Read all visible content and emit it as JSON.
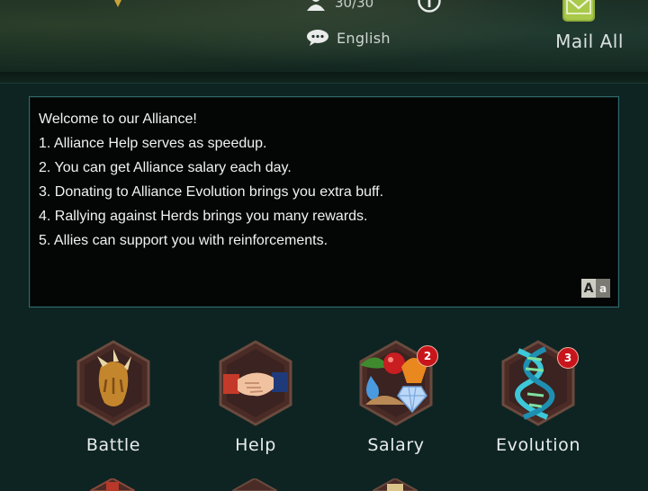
{
  "header": {
    "member_count": "30/30",
    "language": "English",
    "mail_all_label": "Mail All"
  },
  "announcement": {
    "lines": [
      "Welcome to our Alliance!",
      "1. Alliance Help serves as speedup.",
      "2. You can get Alliance salary each day.",
      "3. Donating to Alliance Evolution brings you extra buff.",
      "4. Rallying against Herds brings you many rewards.",
      "5. Allies can support you with reinforcements."
    ],
    "font_button": {
      "big": "A",
      "small": "a"
    }
  },
  "menu": [
    {
      "label": "Battle",
      "icon": "claw-icon"
    },
    {
      "label": "Help",
      "icon": "handshake-icon"
    },
    {
      "label": "Salary",
      "icon": "resources-icon",
      "badge": "2"
    },
    {
      "label": "Evolution",
      "icon": "dna-icon",
      "badge": "3"
    }
  ],
  "colors": {
    "background": "#0d2423",
    "panel_border": "#2f6b6e",
    "badge": "#c8151b"
  }
}
